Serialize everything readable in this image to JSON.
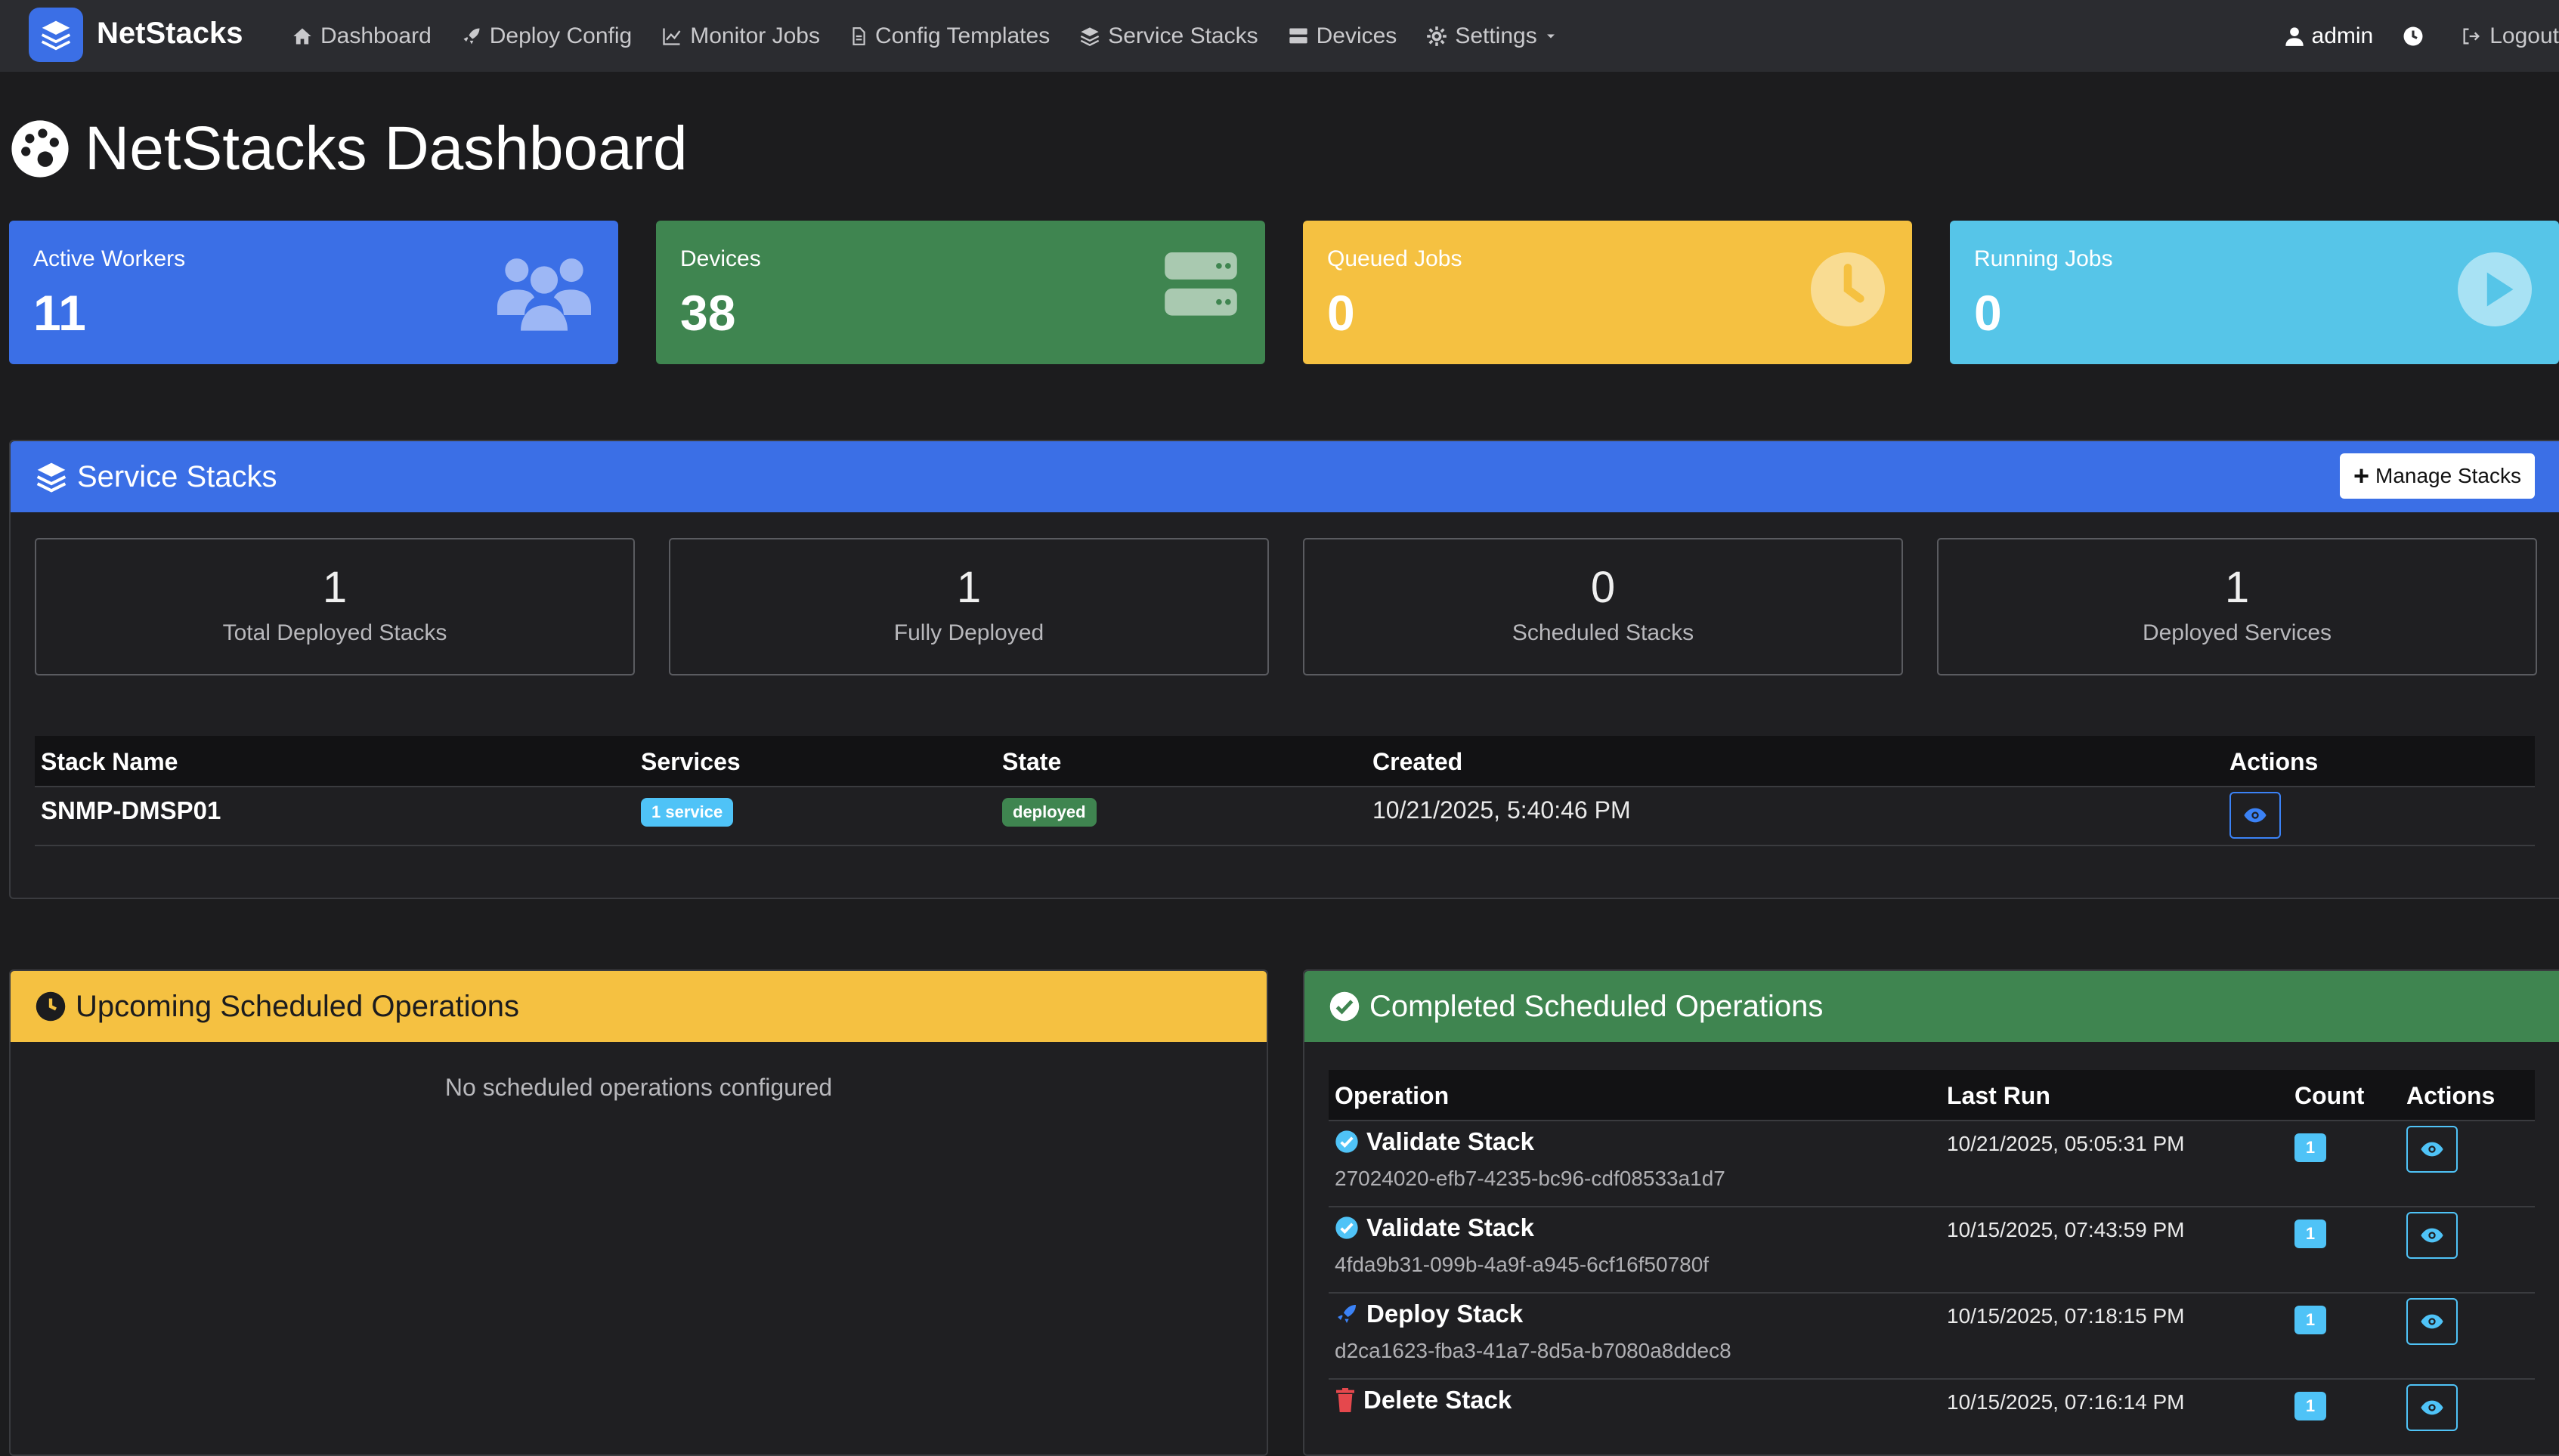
{
  "nav": {
    "brand": "NetStacks",
    "items": [
      "Dashboard",
      "Deploy Config",
      "Monitor Jobs",
      "Config Templates",
      "Service Stacks",
      "Devices",
      "Settings"
    ],
    "user": "admin",
    "logout": "Logout"
  },
  "page": {
    "title": "NetStacks Dashboard"
  },
  "stats": [
    {
      "label": "Active Workers",
      "value": "11",
      "color": "#3b6fe6",
      "icon": "users-icon"
    },
    {
      "label": "Devices",
      "value": "38",
      "color": "#3f8550",
      "icon": "server-icon"
    },
    {
      "label": "Queued Jobs",
      "value": "0",
      "color": "#f5c141",
      "icon": "clock-icon"
    },
    {
      "label": "Running Jobs",
      "value": "0",
      "color": "#56c5e8",
      "icon": "play-icon"
    }
  ],
  "service_stacks": {
    "title": "Service Stacks",
    "manage_button": "Manage Stacks",
    "summary": [
      {
        "value": "1",
        "label": "Total Deployed Stacks"
      },
      {
        "value": "1",
        "label": "Fully Deployed"
      },
      {
        "value": "0",
        "label": "Scheduled Stacks"
      },
      {
        "value": "1",
        "label": "Deployed Services"
      }
    ],
    "columns": [
      "Stack Name",
      "Services",
      "State",
      "Created",
      "Actions"
    ],
    "rows": [
      {
        "name": "SNMP-DMSP01",
        "services": "1 service",
        "state": "deployed",
        "created": "10/21/2025, 5:40:46 PM"
      }
    ]
  },
  "upcoming": {
    "title": "Upcoming Scheduled Operations",
    "empty": "No scheduled operations configured"
  },
  "completed": {
    "title": "Completed Scheduled Operations",
    "columns": [
      "Operation",
      "Last Run",
      "Count",
      "Actions"
    ],
    "rows": [
      {
        "operation": "Validate Stack",
        "id": "27024020-efb7-4235-bc96-cdf08533a1d7",
        "last_run": "10/21/2025, 05:05:31 PM",
        "count": "1",
        "icon": "check-circle-icon"
      },
      {
        "operation": "Validate Stack",
        "id": "4fda9b31-099b-4a9f-a945-6cf16f50780f",
        "last_run": "10/15/2025, 07:43:59 PM",
        "count": "1",
        "icon": "check-circle-icon"
      },
      {
        "operation": "Deploy Stack",
        "id": "d2ca1623-fba3-41a7-8d5a-b7080a8ddec8",
        "last_run": "10/15/2025, 07:18:15 PM",
        "count": "1",
        "icon": "rocket-icon"
      },
      {
        "operation": "Delete Stack",
        "id": "",
        "last_run": "10/15/2025, 07:16:14 PM",
        "count": "1",
        "icon": "trash-icon"
      }
    ]
  }
}
